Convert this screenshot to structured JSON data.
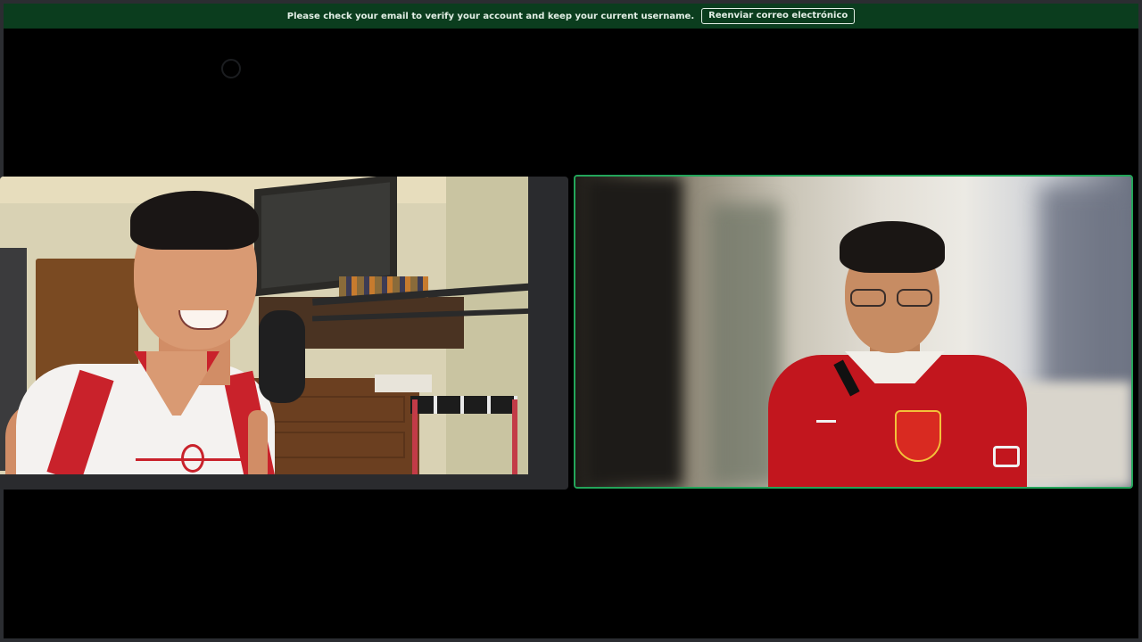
{
  "notice": {
    "message": "Please check your email to verify your account and keep your current username.",
    "resend_button_label": "Reenviar correo electrónico"
  },
  "colors": {
    "notice_bar_background": "#0b3d1e",
    "speaking_indicator_border": "#23a55a",
    "stage_background": "#000000",
    "tile_background": "#2a2b2e"
  },
  "participants": [
    {
      "tile": "left",
      "speaking": false,
      "video_on": true
    },
    {
      "tile": "right",
      "speaking": true,
      "video_on": true
    }
  ],
  "icons": {
    "loading": "loading-ring-icon"
  }
}
